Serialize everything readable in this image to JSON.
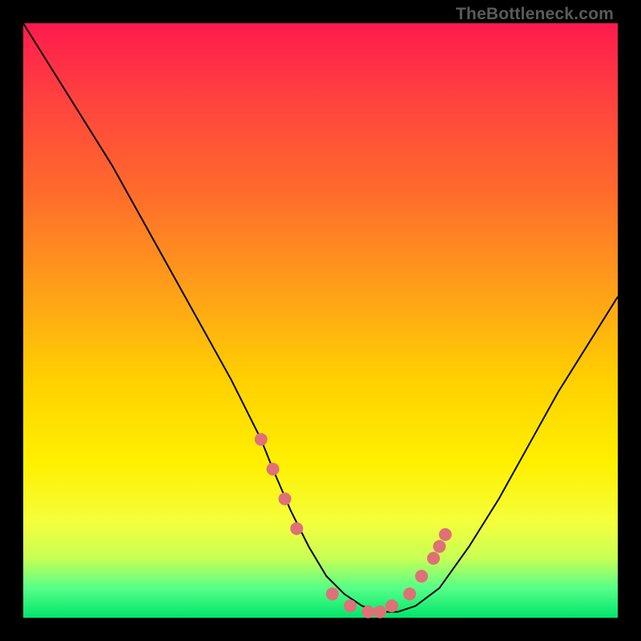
{
  "source_label": "TheBottleneck.com",
  "chart_data": {
    "type": "line",
    "title": "",
    "xlabel": "",
    "ylabel": "",
    "xlim": [
      0,
      100
    ],
    "ylim": [
      0,
      100
    ],
    "series": [
      {
        "name": "curve",
        "x": [
          0,
          5,
          10,
          15,
          20,
          25,
          30,
          35,
          40,
          42,
          45,
          48,
          51,
          54,
          57,
          60,
          63,
          66,
          70,
          75,
          80,
          85,
          90,
          95,
          100
        ],
        "values": [
          100,
          92,
          84,
          76,
          67,
          58,
          49,
          40,
          30,
          25,
          18,
          12,
          7,
          4,
          2,
          1,
          1,
          2,
          5,
          12,
          20,
          29,
          38,
          46,
          54
        ]
      }
    ],
    "markers": {
      "name": "highlight-points",
      "color": "#e07078",
      "x": [
        40,
        42,
        44,
        46,
        52,
        55,
        58,
        60,
        62,
        65,
        67,
        69,
        70,
        71
      ],
      "values": [
        30,
        25,
        20,
        15,
        4,
        2,
        1,
        1,
        2,
        4,
        7,
        10,
        12,
        14
      ]
    },
    "gradient_stops": [
      {
        "pos": 0,
        "color": "#ff1a4d"
      },
      {
        "pos": 45,
        "color": "#ffa019"
      },
      {
        "pos": 74,
        "color": "#fff000"
      },
      {
        "pos": 100,
        "color": "#00e56a"
      }
    ]
  }
}
